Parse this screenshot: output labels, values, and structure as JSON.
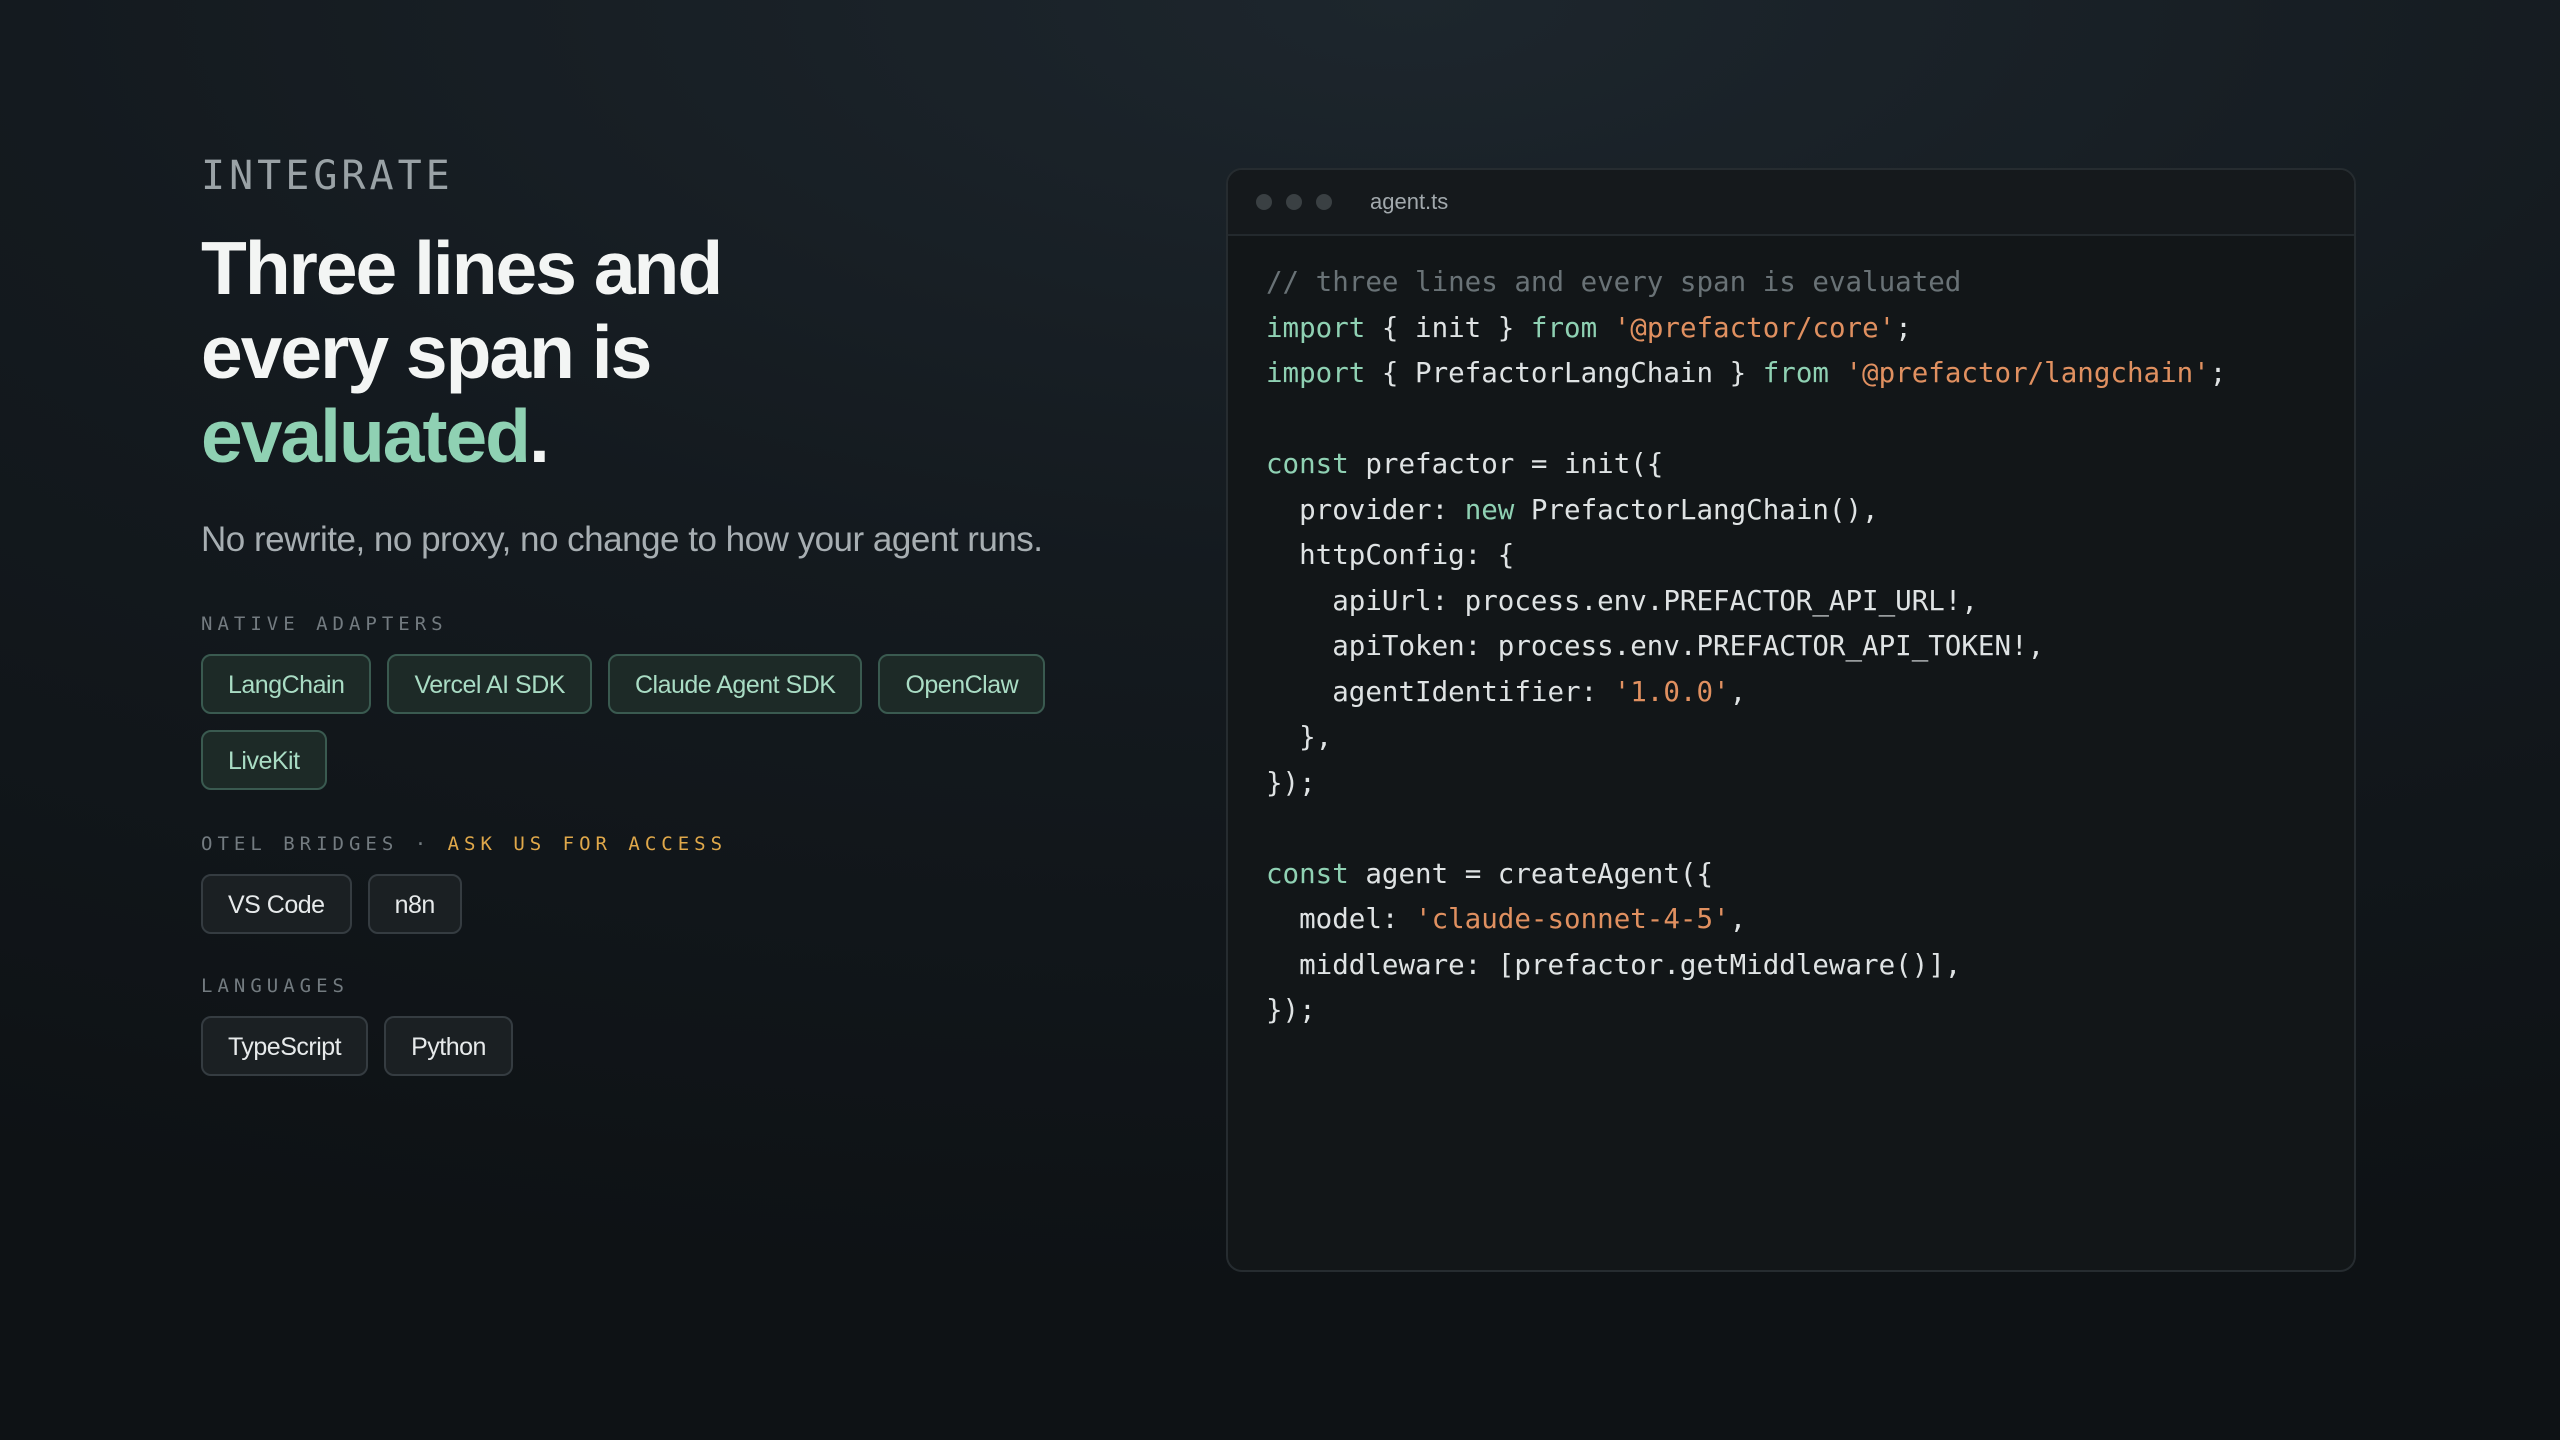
{
  "hero": {
    "eyebrow": "INTEGRATE",
    "headline_line1": "Three lines and",
    "headline_line2": "every span is",
    "headline_accent": "evaluated",
    "headline_period": ".",
    "subtitle": "No rewrite, no proxy, no change to how your agent runs."
  },
  "native_adapters": {
    "label": "NATIVE ADAPTERS",
    "items": [
      "LangChain",
      "Vercel AI SDK",
      "Claude Agent SDK",
      "OpenClaw",
      "LiveKit"
    ]
  },
  "otel_bridges": {
    "label": "OTEL BRIDGES · ",
    "label_highlight": "ASK US FOR ACCESS",
    "items": [
      "VS Code",
      "n8n"
    ]
  },
  "languages": {
    "label": "LANGUAGES",
    "items": [
      "TypeScript",
      "Python"
    ]
  },
  "editor": {
    "filename": "agent.ts",
    "window_dots": [
      "close-dot-icon",
      "minimize-dot-icon",
      "maximize-dot-icon"
    ],
    "lines": [
      [
        [
          "// three lines and every span is evaluated",
          "com"
        ]
      ],
      [
        [
          "import",
          "kw"
        ],
        [
          " { init } ",
          ""
        ],
        [
          "from",
          "kw"
        ],
        [
          " ",
          ""
        ],
        [
          "'@prefactor/core'",
          "str"
        ],
        [
          ";",
          ""
        ]
      ],
      [
        [
          "import",
          "kw"
        ],
        [
          " { PrefactorLangChain } ",
          ""
        ],
        [
          "from",
          "kw"
        ],
        [
          " ",
          ""
        ],
        [
          "'@prefactor/langchain'",
          "str"
        ],
        [
          ";",
          ""
        ]
      ],
      [],
      [
        [
          "const",
          "kw"
        ],
        [
          " prefactor = init({",
          ""
        ]
      ],
      [
        [
          "  provider: ",
          ""
        ],
        [
          "new",
          "kw"
        ],
        [
          " PrefactorLangChain(),",
          ""
        ]
      ],
      [
        [
          "  httpConfig: {",
          ""
        ]
      ],
      [
        [
          "    apiUrl: process.env.PREFACTOR_API_URL!,",
          ""
        ]
      ],
      [
        [
          "    apiToken: process.env.PREFACTOR_API_TOKEN!,",
          ""
        ]
      ],
      [
        [
          "    agentIdentifier: ",
          ""
        ],
        [
          "'1.0.0'",
          "str"
        ],
        [
          ",",
          ""
        ]
      ],
      [
        [
          "  },",
          ""
        ]
      ],
      [
        [
          "});",
          ""
        ]
      ],
      [],
      [
        [
          "const",
          "kw"
        ],
        [
          " agent = createAgent({",
          ""
        ]
      ],
      [
        [
          "  model: ",
          ""
        ],
        [
          "'claude-sonnet-4-5'",
          "str"
        ],
        [
          ",",
          ""
        ]
      ],
      [
        [
          "  middleware: [prefactor.getMiddleware()],",
          ""
        ]
      ],
      [
        [
          "});",
          ""
        ]
      ]
    ]
  },
  "colors": {
    "accent": "#8fd1b3",
    "highlight": "#e0a84a",
    "string": "#e09060",
    "background": "#141a1f"
  }
}
